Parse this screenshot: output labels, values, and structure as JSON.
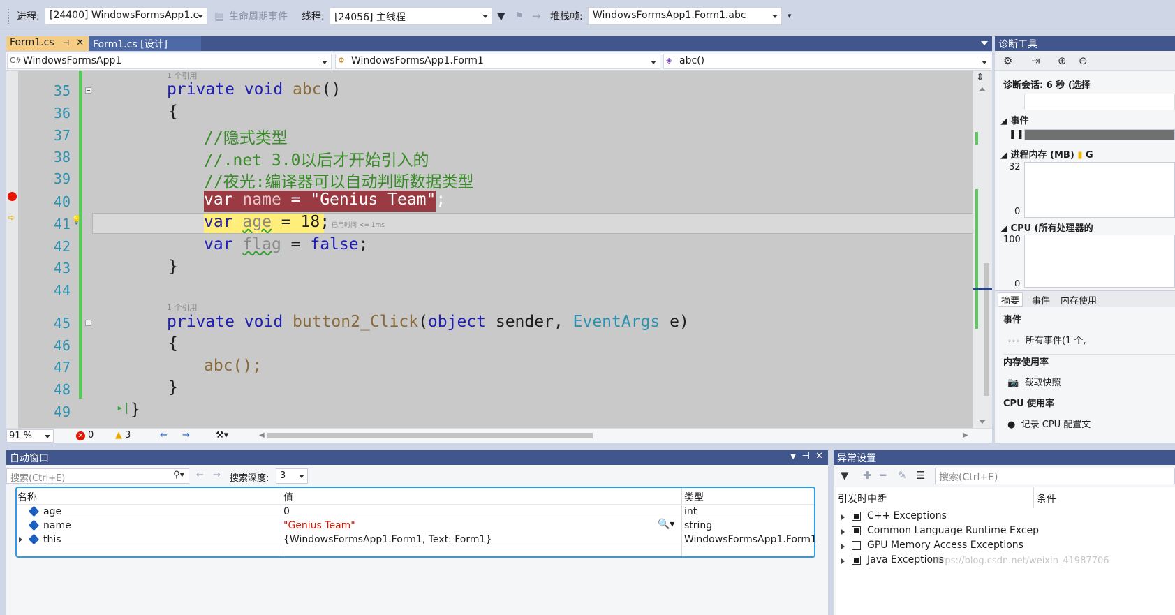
{
  "toolbar": {
    "process_label": "进程:",
    "process_value": "[24400] WindowsFormsApp1.e",
    "lifecycle_label": "生命周期事件",
    "thread_label": "线程:",
    "thread_value": "[24056] 主线程",
    "stackframe_label": "堆栈帧:",
    "stackframe_value": "WindowsFormsApp1.Form1.abc"
  },
  "editor_tabs": [
    {
      "label": "Form1.cs",
      "active": true
    },
    {
      "label": "Form1.cs [设计]",
      "active": false
    }
  ],
  "navbar": {
    "project": "WindowsFormsApp1",
    "type": "WindowsFormsApp1.Form1",
    "member": "abc()"
  },
  "code": {
    "line_numbers": [
      "35",
      "36",
      "37",
      "38",
      "39",
      "40",
      "41",
      "42",
      "43",
      "44",
      "45",
      "46",
      "47",
      "48",
      "49"
    ],
    "refs_label": "1 个引用",
    "line35": {
      "kw1": "private",
      "kw2": "void",
      "name": "abc",
      "paren": "()"
    },
    "brace_open": "{",
    "brace_close": "}",
    "comment1": "//隐式类型",
    "comment2": "//.net 3.0以后才开始引入的",
    "comment3": "//夜光:编译器可以自动判断数据类型",
    "line40": {
      "kw": "var",
      "id": "name",
      "op": " = ",
      "str": "\"Genius Team\"",
      "end": ";"
    },
    "line41": {
      "kw": "var",
      "id": "age",
      "rest": " = 18;"
    },
    "elapsed": "已用时间 <= 1ms",
    "line42": {
      "kw": "var",
      "id": "flag",
      "op": " = ",
      "val": "false",
      "end": ";"
    },
    "line45": {
      "kw1": "private",
      "kw2": "void",
      "name": "button2_Click",
      "p1": "(",
      "kw3": "object",
      "a1": " sender, ",
      "ty": "EventArgs",
      "a2": " e)"
    },
    "line47": "abc();"
  },
  "editor_status": {
    "zoom": "91 %",
    "errors": "0",
    "warnings": "3"
  },
  "diagnostics": {
    "title": "诊断工具",
    "session": "诊断会话: 6 秒 (选择",
    "events_label": "事件",
    "memory_label": "进程内存 (MB)",
    "memory_legend": "G",
    "memory_max": "32",
    "memory_min": "0",
    "cpu_label": "CPU (所有处理器的",
    "cpu_max": "100",
    "cpu_min": "0",
    "tabs": [
      "摘要",
      "事件",
      "内存使用"
    ],
    "sec_events": "事件",
    "all_events": "所有事件(1 个,",
    "sec_memory": "内存使用率",
    "snapshot": "截取快照",
    "sec_cpu": "CPU 使用率",
    "record_cpu": "记录 CPU 配置文"
  },
  "autos": {
    "title": "自动窗口",
    "search_placeholder": "搜索(Ctrl+E)",
    "depth_label": "搜索深度:",
    "depth_value": "3",
    "columns": [
      "名称",
      "值",
      "类型"
    ],
    "rows": [
      {
        "name": "age",
        "value": "0",
        "type": "int",
        "expandable": false
      },
      {
        "name": "name",
        "value": "\"Genius Team\"",
        "type": "string",
        "expandable": false
      },
      {
        "name": "this",
        "value": "{WindowsFormsApp1.Form1, Text: Form1}",
        "type": "WindowsFormsApp1.Form1",
        "expandable": true
      }
    ]
  },
  "exceptions": {
    "title": "异常设置",
    "search_placeholder": "搜索(Ctrl+E)",
    "col_break": "引发时中断",
    "col_cond": "条件",
    "items": [
      {
        "label": "C++ Exceptions",
        "checked": true
      },
      {
        "label": "Common Language Runtime Excep",
        "checked": true
      },
      {
        "label": "GPU Memory Access Exceptions",
        "checked": false
      },
      {
        "label": "Java Exceptions",
        "checked": true
      }
    ]
  },
  "watermark": "https://blog.csdn.net/weixin_41987706"
}
